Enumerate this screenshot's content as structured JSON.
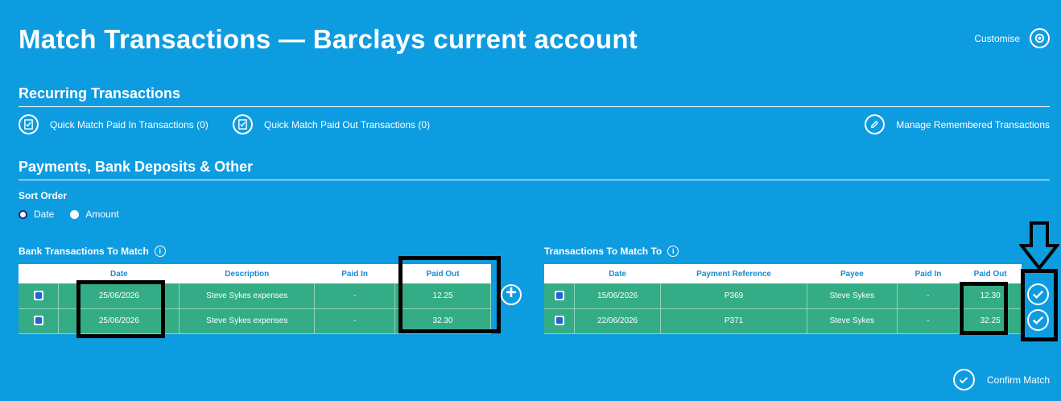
{
  "header": {
    "title": "Match Transactions — Barclays current account",
    "customise_label": "Customise"
  },
  "recurring": {
    "title": "Recurring Transactions",
    "quick_paid_in": "Quick Match Paid In Transactions (0)",
    "quick_paid_out": "Quick Match Paid Out Transactions (0)",
    "manage": "Manage Remembered Transactions"
  },
  "payments": {
    "title": "Payments, Bank Deposits & Other",
    "sort_label": "Sort Order",
    "sort_options": [
      "Date",
      "Amount"
    ],
    "sort_selected": "Date"
  },
  "bank_table": {
    "title": "Bank Transactions To Match",
    "columns": [
      "Date",
      "Description",
      "Paid In",
      "Paid Out"
    ],
    "rows": [
      {
        "checked": true,
        "date": "25/06/2026",
        "description": "Steve Sykes expenses",
        "paid_in": "-",
        "paid_out": "12.25"
      },
      {
        "checked": true,
        "date": "25/06/2026",
        "description": "Steve Sykes expenses",
        "paid_in": "-",
        "paid_out": "32.30"
      }
    ]
  },
  "match_table": {
    "title": "Transactions To Match To",
    "columns": [
      "Date",
      "Payment Reference",
      "Payee",
      "Paid In",
      "Paid Out"
    ],
    "rows": [
      {
        "checked": true,
        "date": "15/06/2026",
        "ref": "P369",
        "payee": "Steve Sykes",
        "paid_in": "-",
        "paid_out": "12.30"
      },
      {
        "checked": true,
        "date": "22/06/2026",
        "ref": "P371",
        "payee": "Steve Sykes",
        "paid_in": "-",
        "paid_out": "32.25"
      }
    ]
  },
  "footer": {
    "confirm_label": "Confirm Match"
  },
  "colors": {
    "background": "#0e9ce0",
    "row_green": "#34ad86",
    "header_text": "#1c8ad0"
  },
  "icons": [
    "gear-icon",
    "quick-match-icon",
    "pencil-icon",
    "info-icon",
    "plus-icon",
    "check-circle-icon",
    "down-arrow-icon"
  ]
}
